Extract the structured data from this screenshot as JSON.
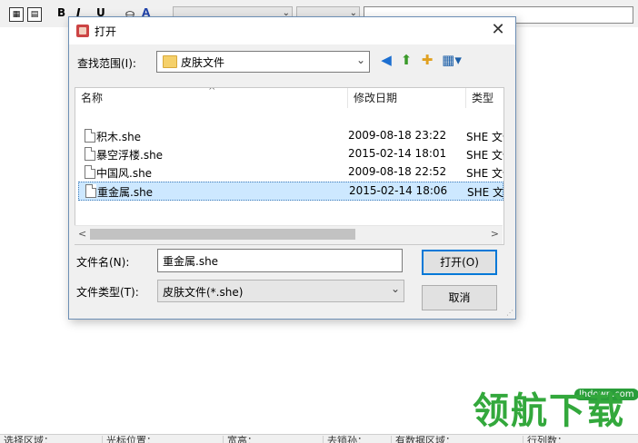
{
  "toolbar": {
    "bold": "B",
    "italic": "I",
    "underline": "U",
    "font_color": "A"
  },
  "dialog": {
    "title": "打开",
    "close": "✕",
    "lookin_label": "查找范围(I):",
    "lookin_value": "皮肤文件",
    "columns": [
      "名称",
      "修改日期",
      "类型"
    ],
    "files": [
      {
        "name": "积木.she",
        "date": "2009-08-18 23:22",
        "type": "SHE 文件"
      },
      {
        "name": "暴空浮楼.she",
        "date": "2015-02-14 18:01",
        "type": "SHE 文件"
      },
      {
        "name": "中国风.she",
        "date": "2009-08-18 22:52",
        "type": "SHE 文件"
      },
      {
        "name": "重金属.she",
        "date": "2015-02-14 18:06",
        "type": "SHE 文件"
      }
    ],
    "selected_index": 3,
    "filename_label": "文件名(N):",
    "filename_value": "重金属.she",
    "filetype_label": "文件类型(T):",
    "filetype_value": "皮肤文件(*.she)",
    "open_button": "打开(O)",
    "cancel_button": "取消"
  },
  "statusbar": {
    "cells": [
      "选择区域：",
      "光标位置：",
      "宽高：",
      "去锁孙：",
      "有数据区域：",
      "行列数："
    ]
  },
  "watermark": {
    "url": "lhdown.com",
    "text": "领航下载"
  },
  "colors": {
    "dialog_border": "#6d8fb5",
    "selection_bg": "#cde8ff",
    "default_button_border": "#0078d7",
    "watermark_green": "#33a83c"
  }
}
